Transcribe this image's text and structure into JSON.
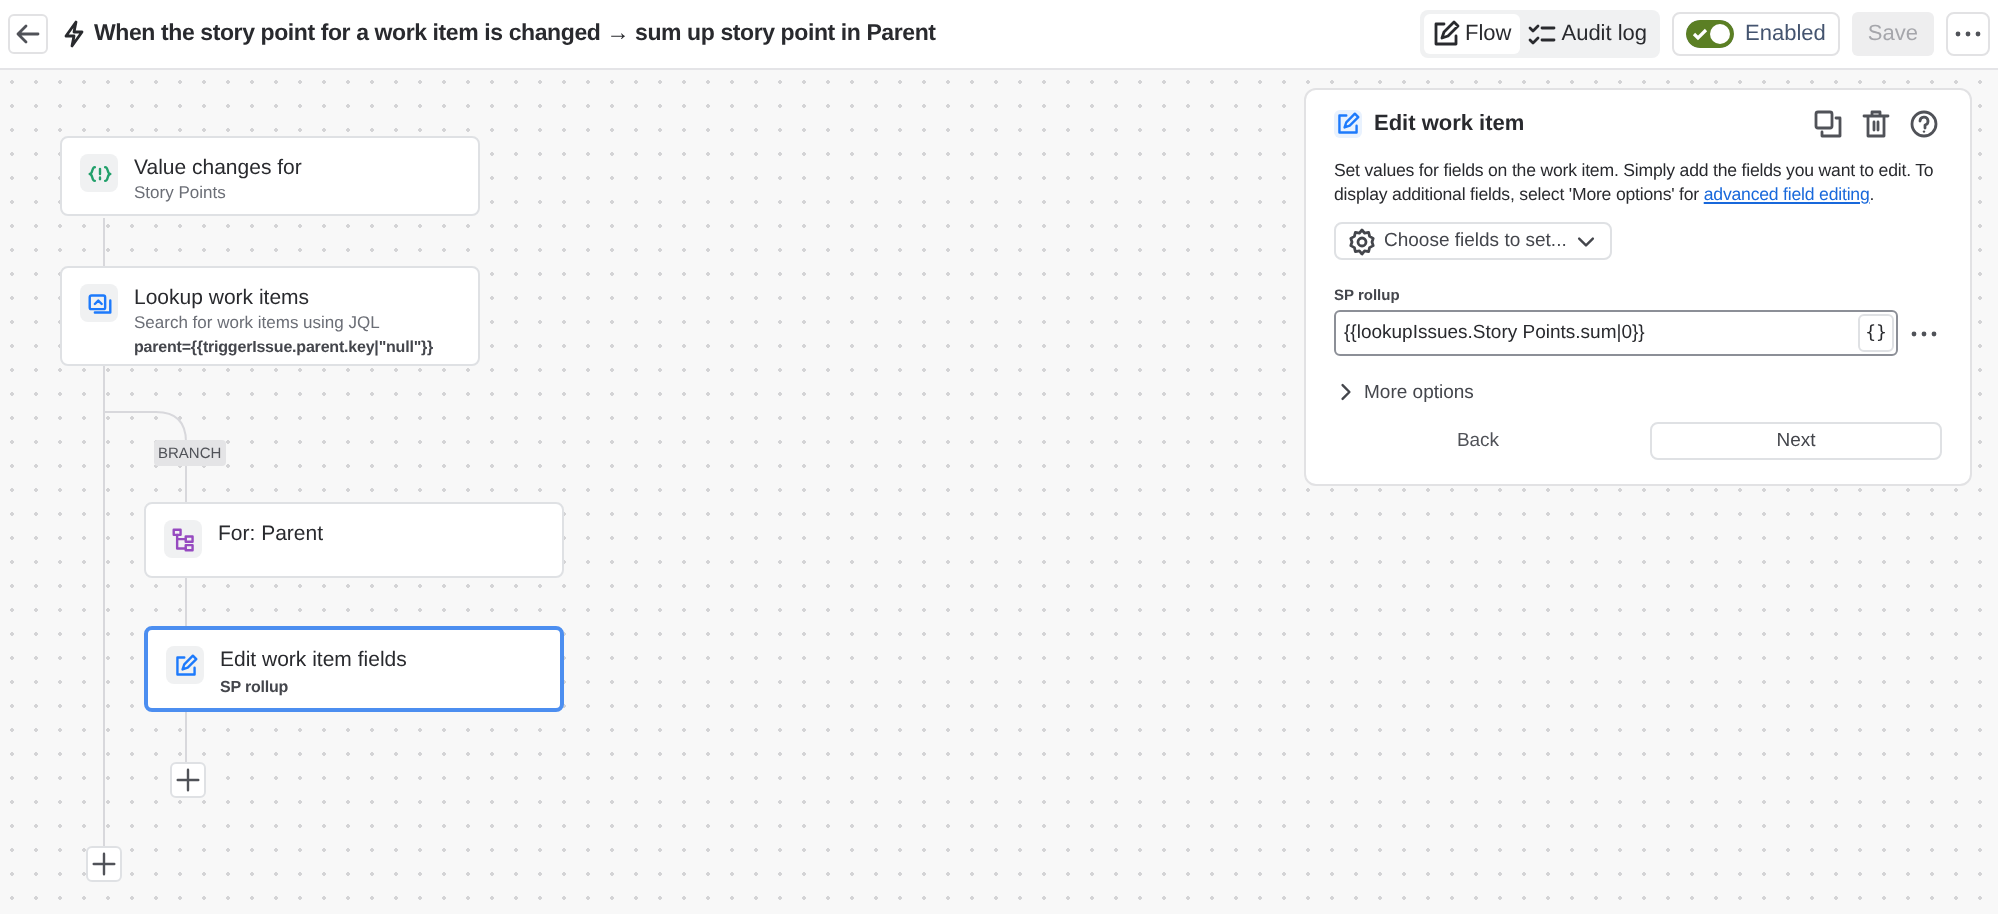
{
  "header": {
    "title": "When the story point for a work item is changed → sum up story point in Parent",
    "view_tabs": [
      {
        "label": "Flow",
        "kind": "flow",
        "selected": true
      },
      {
        "label": "Audit log",
        "kind": "audit",
        "selected": false
      }
    ],
    "toggle": {
      "label": "Enabled",
      "on": true
    },
    "save": {
      "label": "Save",
      "disabled": true
    }
  },
  "nodes": [
    {
      "kind": "trigger",
      "title": "Value changes for",
      "subtitle": "Story Points",
      "selected": false
    },
    {
      "kind": "lookup",
      "title": "Lookup work items",
      "subtitle": "Search for work items using JQL",
      "detail": "parent={{triggerIssue.parent.key|\"null\"}}",
      "selected": false
    },
    {
      "kind": "branch",
      "title": "For: Parent",
      "selected": false
    },
    {
      "kind": "edit",
      "title": "Edit work item fields",
      "detail": "SP rollup",
      "selected": true
    }
  ],
  "branch_label": "BRANCH",
  "panel": {
    "title": "Edit work item",
    "description": "Set values for fields on the work item. Simply add the fields you want to edit. To display additional fields, select 'More options' for",
    "link": "advanced field editing",
    "description_end": ".",
    "choose_button": "Choose fields to set...",
    "field_label": "SP rollup",
    "field_value": "{{lookupIssues.Story Points.sum|0}}",
    "smart_value_button": "{}",
    "more_options": "More options",
    "more_options_expanded": false,
    "back": "Back",
    "next": "Next"
  }
}
